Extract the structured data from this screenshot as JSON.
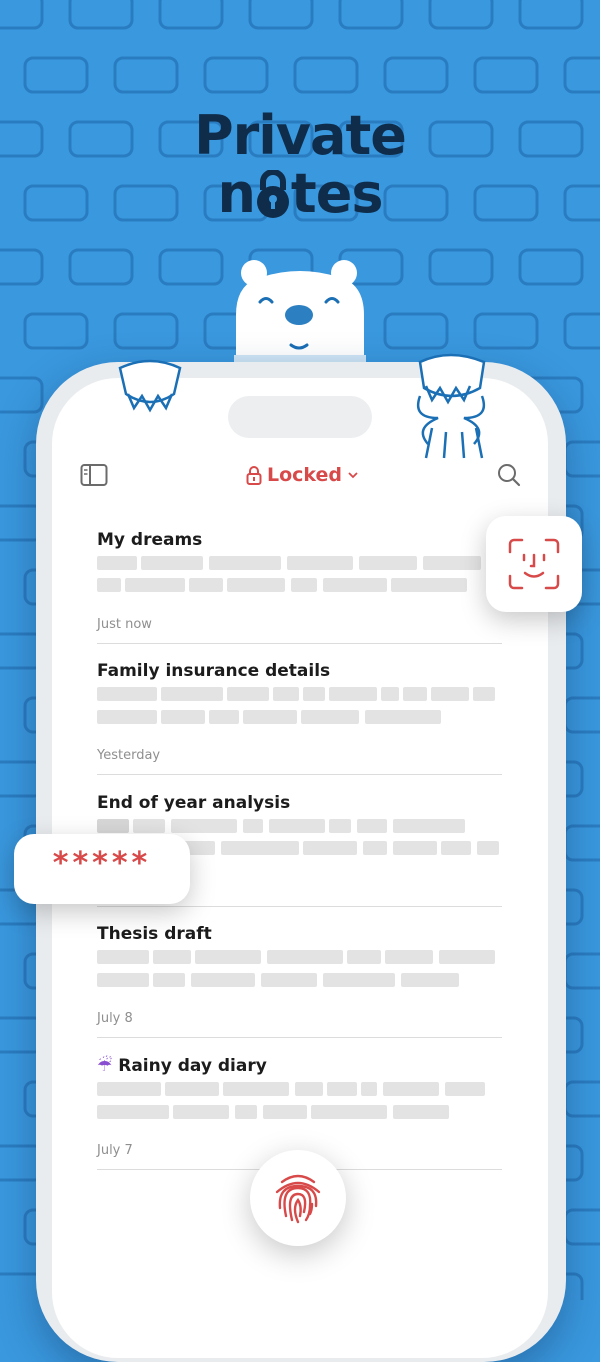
{
  "headline": {
    "line1": "Private",
    "line2_before": "n",
    "line2_after": "tes"
  },
  "toolbar": {
    "sidebar_icon": "sidebar-toggle-icon",
    "title": "Locked",
    "title_icon": "padlock-icon",
    "chevron_icon": "chevron-down-icon",
    "search_icon": "search-icon"
  },
  "notes": [
    {
      "title": "My dreams",
      "date": "Just now"
    },
    {
      "title": "Family insurance details",
      "date": "Yesterday"
    },
    {
      "title": "End of year analysis",
      "date": ""
    },
    {
      "title": "Thesis draft",
      "date": "July 8"
    },
    {
      "title": "Rainy day diary",
      "date": "July 7",
      "emoji": "☔"
    }
  ],
  "overlays": {
    "face_id_icon": "face-id-icon",
    "password_mask": "*****",
    "fingerprint_icon": "fingerprint-icon"
  },
  "colors": {
    "background": "#3a98de",
    "accent": "#d84a4a",
    "headline": "#0f2d4b",
    "placeholder_bar": "#e3e3e3"
  }
}
